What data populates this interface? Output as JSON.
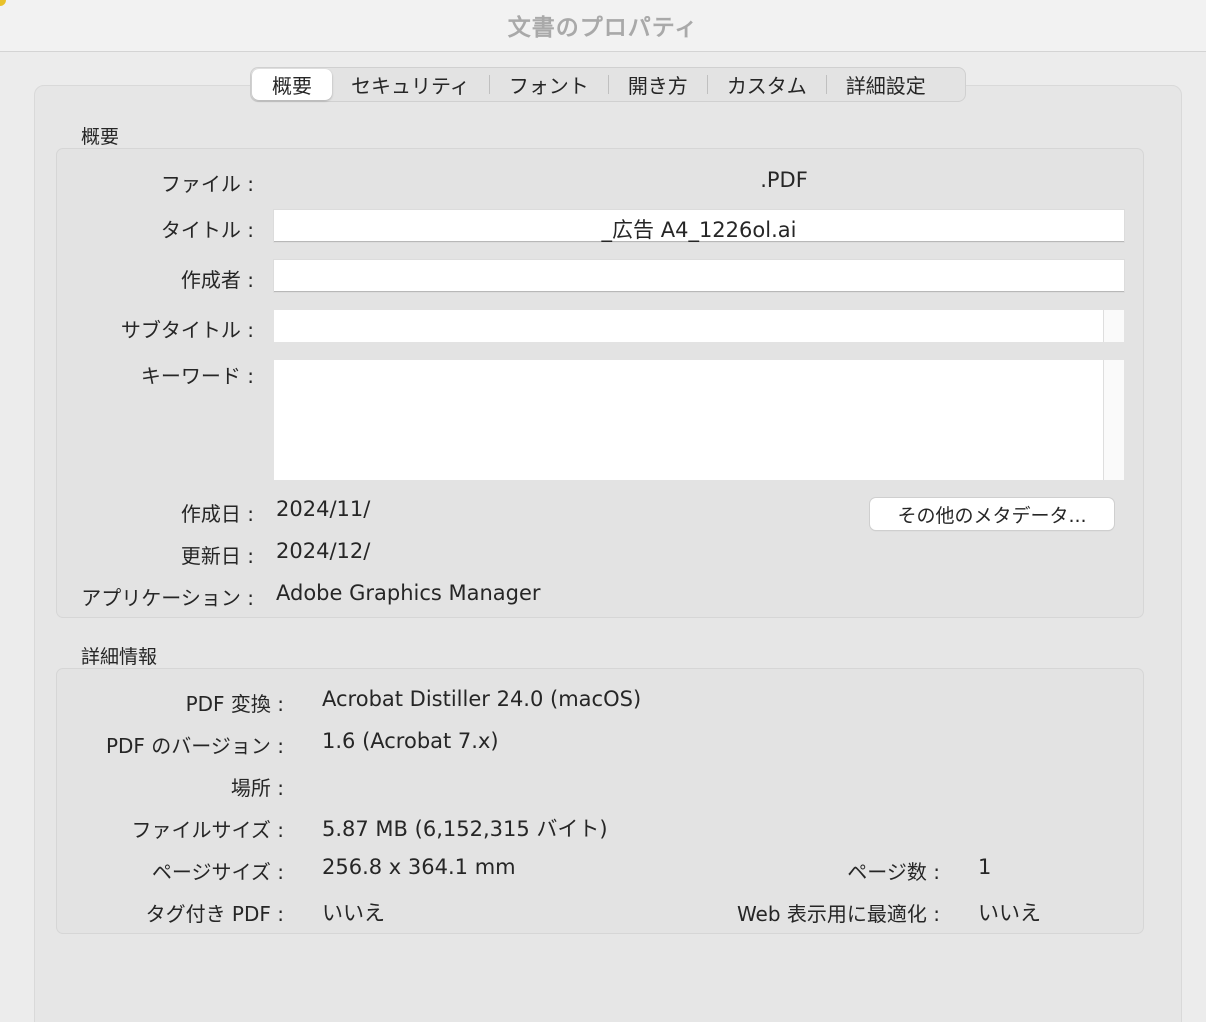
{
  "window": {
    "title": "文書のプロパティ"
  },
  "tabs": [
    {
      "label": "概要",
      "active": true
    },
    {
      "label": "セキュリティ",
      "active": false
    },
    {
      "label": "フォント",
      "active": false
    },
    {
      "label": "開き方",
      "active": false
    },
    {
      "label": "カスタム",
      "active": false
    },
    {
      "label": "詳細設定",
      "active": false
    }
  ],
  "overview": {
    "section_title": "概要",
    "file_label": "ファイル :",
    "file_value": ".PDF",
    "title_label": "タイトル :",
    "title_value": "_広告 A4_1226ol.ai",
    "author_label": "作成者 :",
    "author_value": "",
    "subtitle_label": "サブタイトル :",
    "subtitle_value": "",
    "keywords_label": "キーワード :",
    "keywords_value": "",
    "created_label": "作成日 :",
    "created_value": "2024/11/",
    "modified_label": "更新日 :",
    "modified_value": "2024/12/",
    "application_label": "アプリケーション :",
    "application_value": "Adobe Graphics Manager",
    "more_metadata_button": "その他のメタデータ..."
  },
  "details": {
    "section_title": "詳細情報",
    "producer_label": "PDF 変換 :",
    "producer_value": "Acrobat Distiller 24.0 (macOS)",
    "version_label": "PDF のバージョン :",
    "version_value": "1.6 (Acrobat 7.x)",
    "location_label": "場所 :",
    "location_value": "",
    "filesize_label": "ファイルサイズ :",
    "filesize_value": "5.87 MB (6,152,315 バイト)",
    "pagesize_label": "ページサイズ :",
    "pagesize_value": "256.8 x 364.1 mm",
    "pagecount_label": "ページ数 :",
    "pagecount_value": "1",
    "tagged_label": "タグ付き PDF :",
    "tagged_value": "いいえ",
    "fastweb_label": "Web 表示用に最適化 :",
    "fastweb_value": "いいえ"
  }
}
